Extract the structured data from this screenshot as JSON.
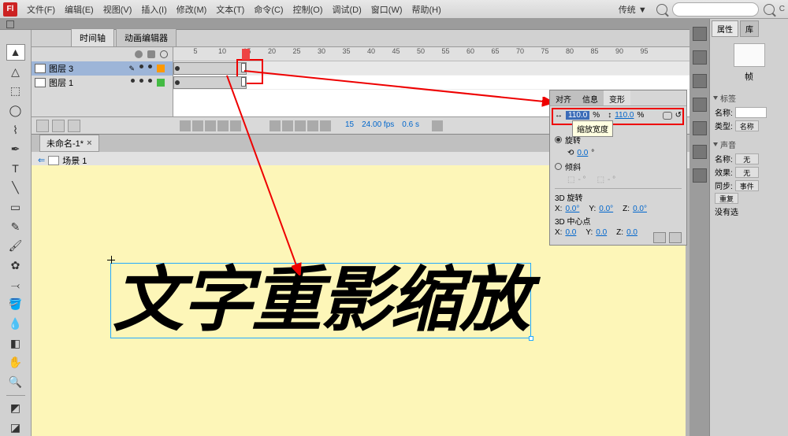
{
  "menu": {
    "items": [
      "文件(F)",
      "编辑(E)",
      "视图(V)",
      "插入(I)",
      "修改(M)",
      "文本(T)",
      "命令(C)",
      "控制(O)",
      "调试(D)",
      "窗口(W)",
      "帮助(H)"
    ],
    "workspace": "传统 ▼"
  },
  "timeline": {
    "tabs": [
      "时间轴",
      "动画编辑器"
    ],
    "layers": [
      {
        "name": "图层 3",
        "selected": true,
        "color": "o"
      },
      {
        "name": "图层 1",
        "selected": false,
        "color": "g"
      }
    ],
    "ruler_step": 5,
    "ruler_max": 95,
    "status": {
      "frame": "15",
      "fps": "24.00 fps",
      "time": "0.6 s"
    }
  },
  "doc": {
    "tab": "未命名-1*",
    "scene": "场景 1"
  },
  "stage": {
    "text": "文字重影缩放"
  },
  "transform": {
    "tabs": [
      "对齐",
      "信息",
      "变形"
    ],
    "scale_w": "110.0",
    "scale_w_unit": "%",
    "scale_h": "110.0",
    "scale_h_unit": "%",
    "tooltip": "缩放宽度",
    "rotate_label": "旋转",
    "rotate_val": "0.0",
    "rotate_unit": "°",
    "skew_label": "倾斜",
    "skew_h": "- °",
    "skew_v": "- °",
    "rot3d_label": "3D 旋转",
    "rot3d": {
      "x": "0.0°",
      "y": "0.0°",
      "z": "0.0°"
    },
    "center3d_label": "3D 中心点",
    "center3d": {
      "x": "0.0",
      "y": "0.0",
      "z": "0.0"
    }
  },
  "props": {
    "tabs": [
      "属性",
      "库"
    ],
    "frame_label": "帧",
    "section_label": "标签",
    "name_label": "名称:",
    "type_label": "类型:",
    "type_value": "名称",
    "sound_section": "声音",
    "sound_name": "名称:",
    "sound_name_val": "无",
    "effect_label": "效果:",
    "effect_val": "无",
    "sync_label": "同步:",
    "sync_val": "事件",
    "repeat_val": "重复",
    "no_more": "没有选"
  }
}
